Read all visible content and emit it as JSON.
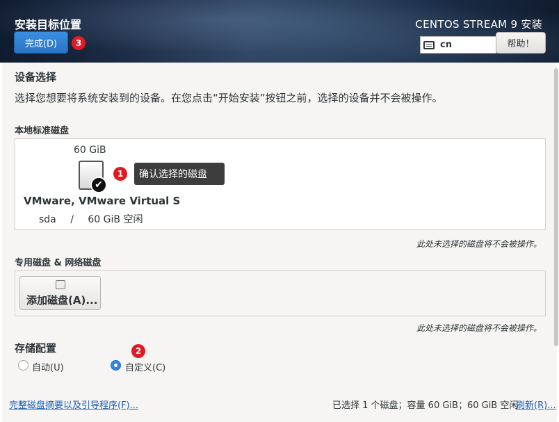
{
  "header": {
    "title": "安装目标位置",
    "done_label": "完成(D)",
    "done_badge": "3",
    "product": "CENTOS STREAM 9 安装",
    "keyboard_layout": "cn",
    "help_label": "帮助！"
  },
  "device_selection": {
    "heading": "设备选择",
    "description": "选择您想要将系统安装到的设备。在您点击“开始安装”按钮之前，选择的设备并不会被操作。"
  },
  "local_disks": {
    "heading": "本地标准磁盘",
    "disk": {
      "size": "60 GiB",
      "name": "VMware, VMware Virtual S",
      "device": "sda",
      "separator": "/",
      "free": "60 GiB 空闲"
    },
    "badge": "1",
    "tooltip": "确认选择的磁盘",
    "note": "此处未选择的磁盘将不会被操作。"
  },
  "special_disks": {
    "heading": "专用磁盘 & 网络磁盘",
    "add_disk_label": "添加磁盘(A)...",
    "note": "此处未选择的磁盘将不会被操作。"
  },
  "storage_config": {
    "heading": "存储配置",
    "badge": "2",
    "options": [
      {
        "label": "自动(U)",
        "selected": false
      },
      {
        "label": "自定义(C)",
        "selected": true
      }
    ]
  },
  "footer": {
    "summary_link": "完整磁盘摘要以及引导程序(F)...",
    "status": "已选择 1 个磁盘；容量 60 GiB；60 GiB 空闲",
    "refresh_link": "刷新(R)..."
  },
  "colors": {
    "accent": "#3584e4",
    "badge": "#e01b24",
    "link": "#1a5fb4"
  }
}
